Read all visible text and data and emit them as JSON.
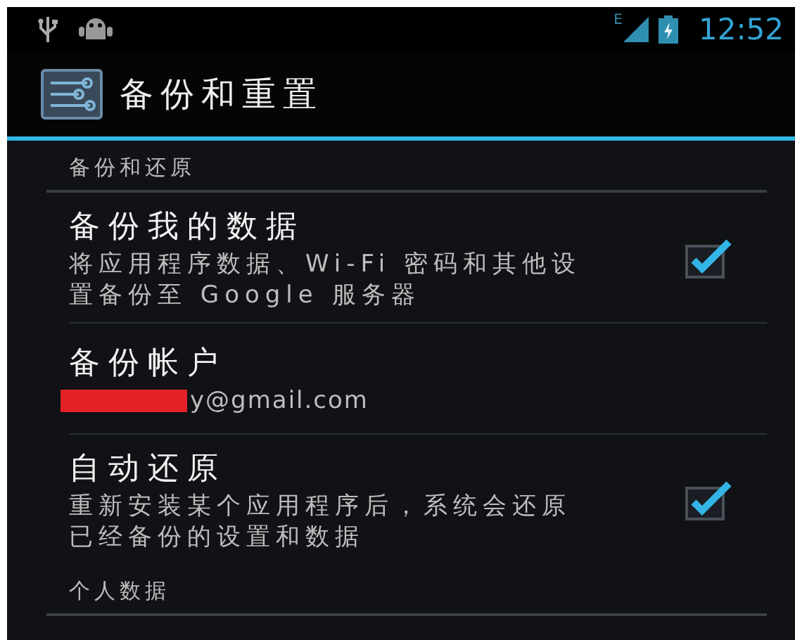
{
  "status_bar": {
    "network": "E",
    "time": "12:52"
  },
  "action_bar": {
    "title": "备份和重置"
  },
  "sections": [
    {
      "header": "备份和还原",
      "items": [
        {
          "kind": "checkbox",
          "title": "备份我的数据",
          "summary": "将应用程序数据、Wi-Fi 密码和其他设置备份至 Google 服务器",
          "checked": true
        },
        {
          "kind": "account",
          "title": "备份帐户",
          "summary": "y@gmail.com",
          "redacted": true
        },
        {
          "kind": "checkbox",
          "title": "自动还原",
          "summary": "重新安装某个应用程序后，系统会还原已经备份的设置和数据",
          "checked": true
        }
      ]
    },
    {
      "header": "个人数据"
    }
  ]
}
